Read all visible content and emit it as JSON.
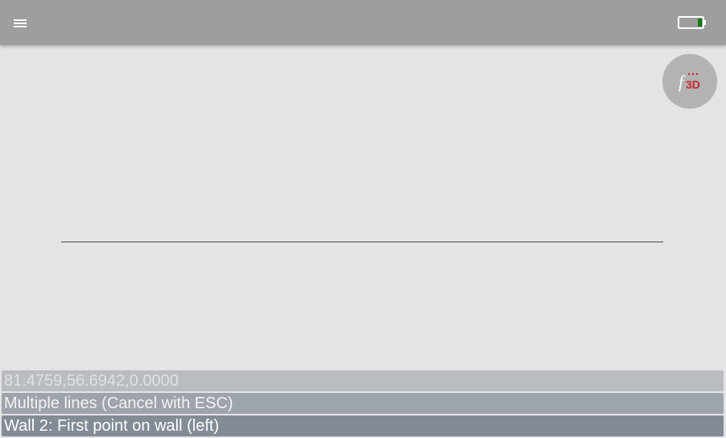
{
  "topbar": {
    "menu_icon": "hamburger-menu-icon",
    "battery_icon": "battery-icon",
    "battery_level": 0.2,
    "battery_fill_color": "#1a7a1a"
  },
  "fab": {
    "logo_text": "f3D",
    "logo_color": "#c62828"
  },
  "canvas": {
    "background": "#e4e4e4",
    "line_color": "#4a4a4a"
  },
  "status": {
    "coordinates": "81.4759,56.6942,0.0000",
    "mode": "Multiple lines (Cancel with ESC)",
    "prompt": "Wall 2: First point on wall (left)"
  }
}
